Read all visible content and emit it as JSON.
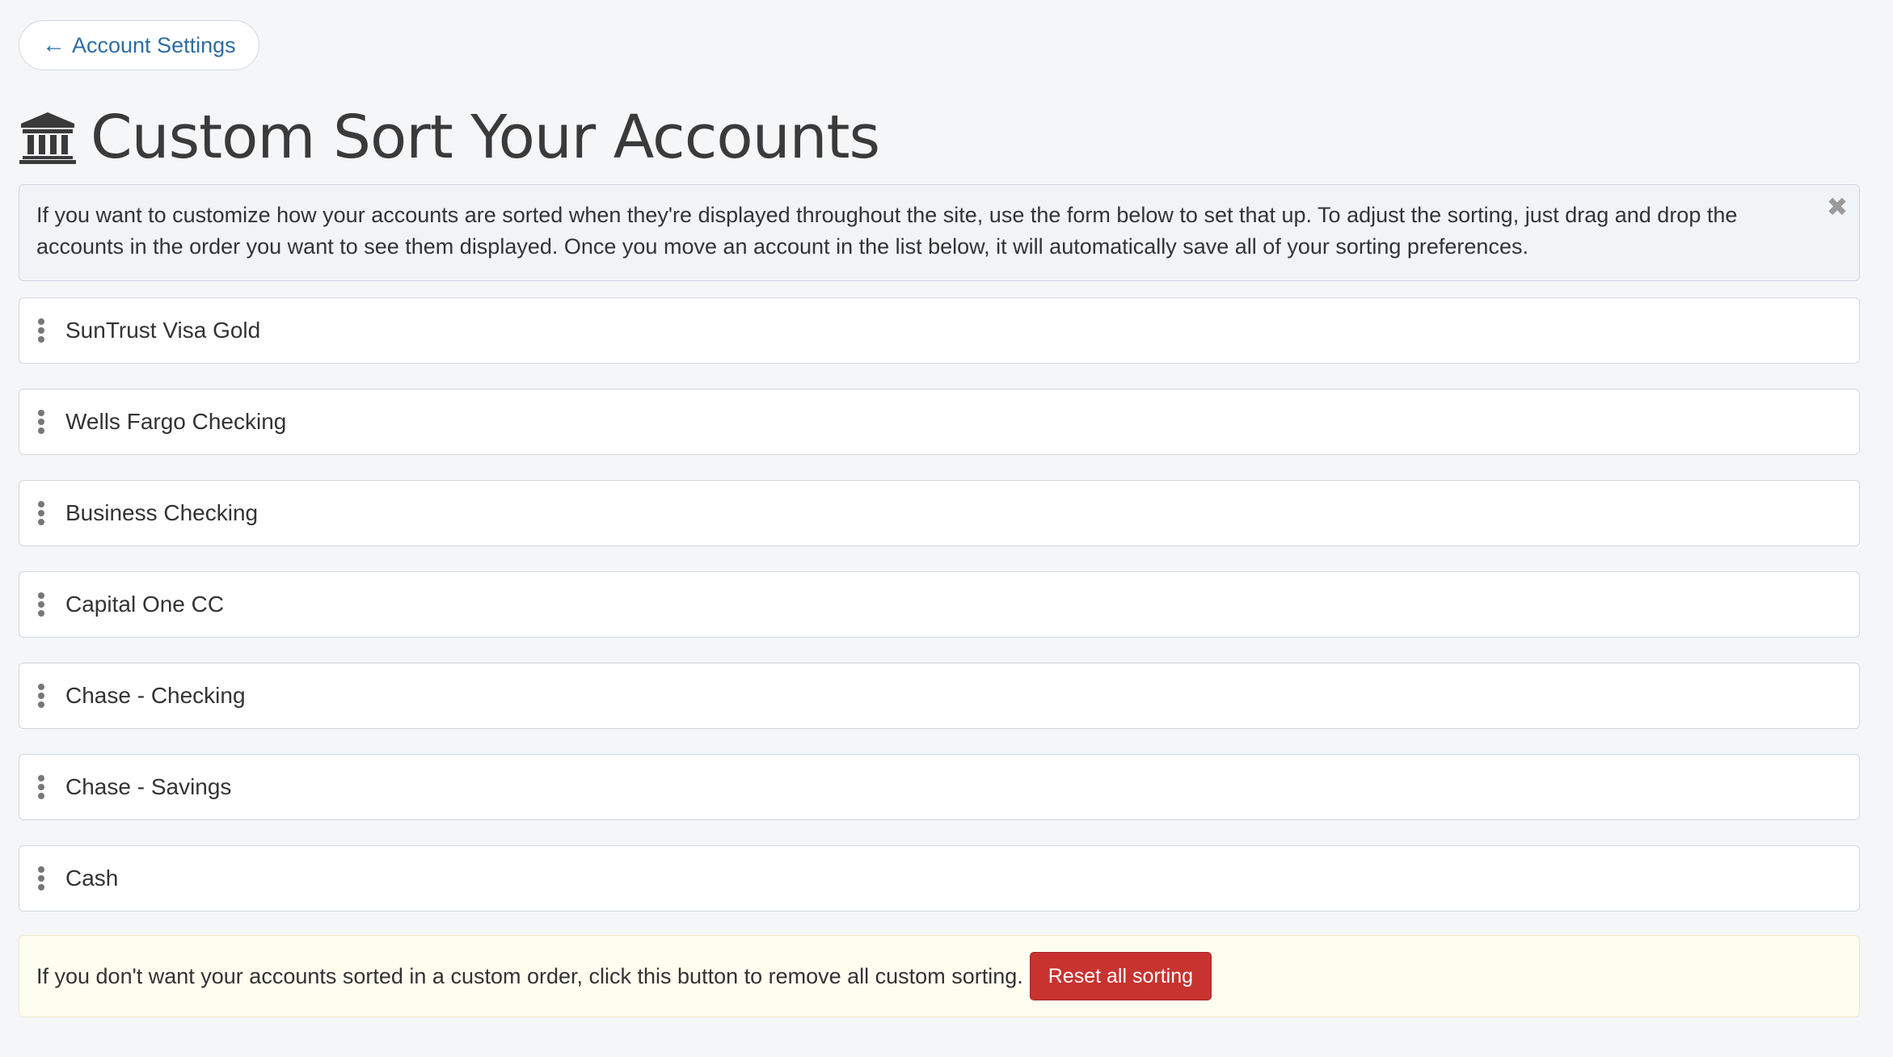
{
  "nav": {
    "back_arrow": "←",
    "back_label": "Account Settings"
  },
  "header": {
    "icon": "bank-icon",
    "title": "Custom Sort Your Accounts"
  },
  "info_alert": {
    "text": "If you want to customize how your accounts are sorted when they're displayed throughout the site, use the form below to set that up. To adjust the sorting, just drag and drop the accounts in the order you want to see them displayed. Once you move an account in the list below, it will automatically save all of your sorting preferences.",
    "close_icon": "close-icon"
  },
  "accounts": [
    {
      "name": "SunTrust Visa Gold"
    },
    {
      "name": "Wells Fargo Checking"
    },
    {
      "name": "Business Checking"
    },
    {
      "name": "Capital One CC"
    },
    {
      "name": "Chase - Checking"
    },
    {
      "name": "Chase - Savings"
    },
    {
      "name": "Cash"
    }
  ],
  "reset": {
    "text": "If you don't want your accounts sorted in a custom order, click this button to remove all custom sorting.",
    "button_label": "Reset all sorting"
  },
  "colors": {
    "link": "#2f6da3",
    "danger": "#c8322f",
    "warning_bg": "#fdfdf0",
    "info_bg": "#f1f4f7"
  }
}
